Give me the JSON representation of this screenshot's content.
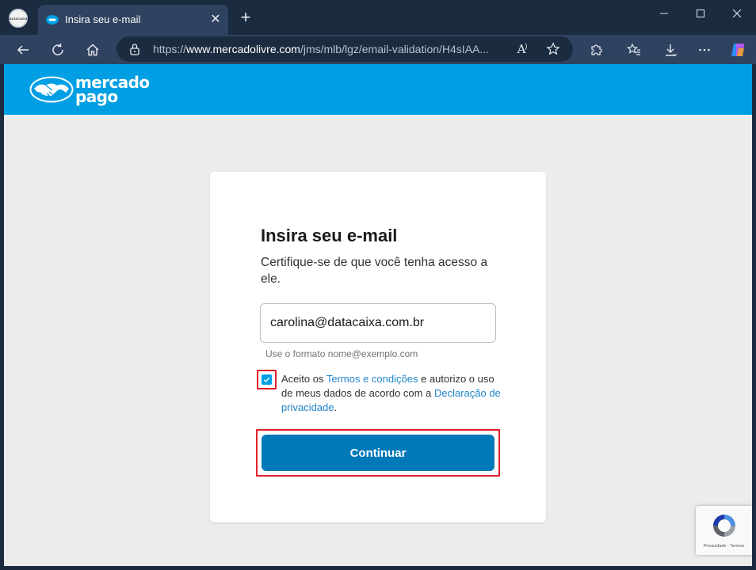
{
  "browser": {
    "tab_title": "Insira seu e-mail",
    "url_prefix": "https://",
    "url_host": "www.mercadolivre.com",
    "url_path": "/jms/mlb/lgz/email-validation/H4sIAA...",
    "profile_label": "DATACAIXA",
    "reader_label": "A"
  },
  "header": {
    "brand_line1": "mercado",
    "brand_line2": "pago"
  },
  "form": {
    "title": "Insira seu e-mail",
    "subtitle": "Certifique-se de que você tenha acesso a ele.",
    "email_value": "carolina@datacaixa.com.br",
    "email_hint": "Use o formato nome@exemplo.com",
    "terms_part1": "Aceito os ",
    "terms_link1": "Termos e condições",
    "terms_part2": " e autorizo o uso de meus dados de acordo com a ",
    "terms_link2": "Declaração de privacidade",
    "terms_part3": ".",
    "continue_label": "Continuar"
  },
  "recaptcha": {
    "footer": "Privacidade - Termos"
  },
  "colors": {
    "mp_blue": "#009ee3",
    "button_blue": "#0079b8",
    "link_blue": "#1f86c8",
    "highlight_red": "#e0202a"
  }
}
